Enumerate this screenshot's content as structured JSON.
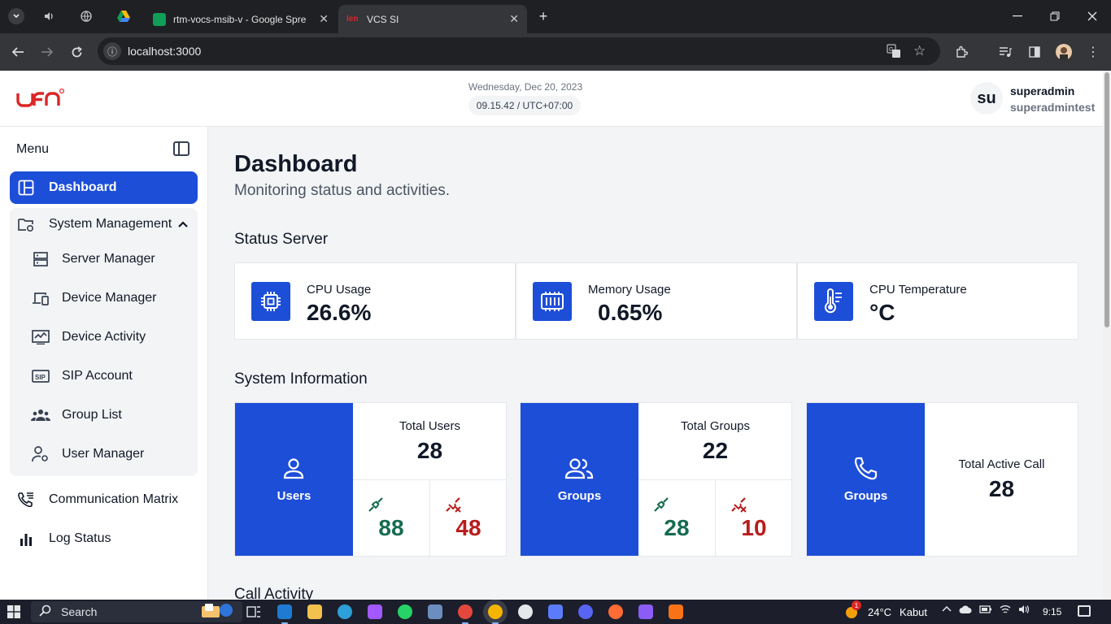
{
  "browser": {
    "tabs": [
      {
        "title": "rtm-vocs-msib-v - Google Spre",
        "active": false
      },
      {
        "title": "VCS SI",
        "active": true
      }
    ],
    "url": "localhost:3000"
  },
  "header": {
    "logo_alt": "len",
    "date": "Wednesday, Dec 20, 2023",
    "time": "09.15.42 / UTC+07:00",
    "avatar_initials": "su",
    "user_name": "superadmin",
    "user_sub": "superadmintest"
  },
  "sidebar": {
    "menu_title": "Menu",
    "items": [
      {
        "label": "Dashboard",
        "icon": "layout-icon",
        "active": true
      },
      {
        "label": "System Management",
        "icon": "folder-gear-icon",
        "expanded": true
      },
      {
        "label": "Communication Matrix",
        "icon": "phone-list-icon"
      },
      {
        "label": "Log Status",
        "icon": "bar-chart-icon"
      }
    ],
    "sub_items": [
      {
        "label": "Server Manager",
        "icon": "server-icon"
      },
      {
        "label": "Device Manager",
        "icon": "devices-icon"
      },
      {
        "label": "Device Activity",
        "icon": "activity-icon"
      },
      {
        "label": "SIP Account",
        "icon": "sip-icon"
      },
      {
        "label": "Group List",
        "icon": "group-icon"
      },
      {
        "label": "User Manager",
        "icon": "user-gear-icon"
      }
    ]
  },
  "main": {
    "title": "Dashboard",
    "subtitle": "Monitoring status and activities.",
    "status_server": {
      "title": "Status Server",
      "cards": [
        {
          "label": "CPU Usage",
          "value": "26.6%",
          "icon": "cpu-icon"
        },
        {
          "label": "Memory Usage",
          "value": "0.65%",
          "icon": "memory-icon"
        },
        {
          "label": "CPU Temperature",
          "value": "°C",
          "icon": "thermometer-icon"
        }
      ]
    },
    "system_info": {
      "title": "System Information",
      "users": {
        "label": "Users",
        "total_label": "Total Users",
        "total": "28",
        "connected": "88",
        "disconnected": "48"
      },
      "groups": {
        "label": "Groups",
        "total_label": "Total Groups",
        "total": "22",
        "connected": "28",
        "disconnected": "10"
      },
      "calls": {
        "label": "Groups",
        "total_label": "Total Active Call",
        "total": "28"
      }
    },
    "call_activity_title": "Call Activity"
  },
  "taskbar": {
    "search_label": "Search",
    "weather_temp": "24°C",
    "weather_desc": "Kabut",
    "clock": "9:15",
    "weather_badge": "1"
  },
  "colors": {
    "accent": "#1d4ed8",
    "connected": "#166b50",
    "disconnected": "#b91c1c"
  }
}
